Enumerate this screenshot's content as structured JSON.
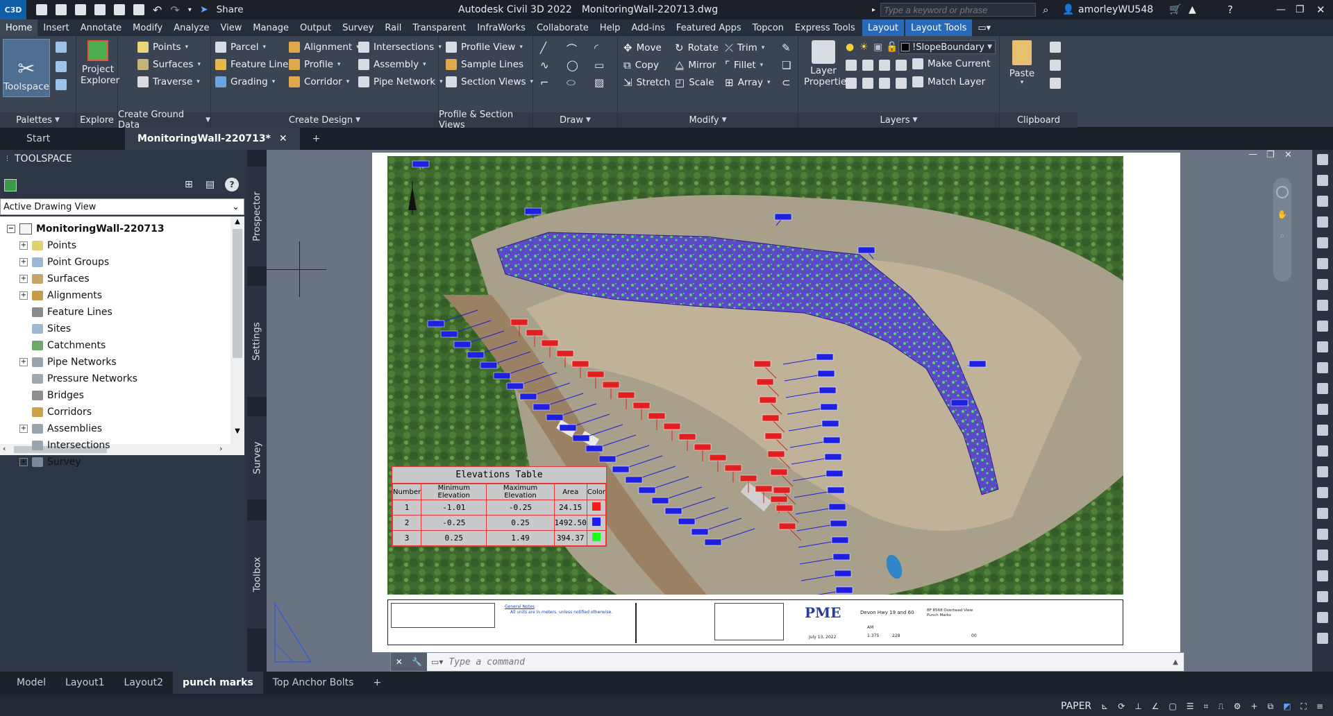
{
  "app": {
    "logo": "C3D",
    "title": "Autodesk Civil 3D 2022",
    "filename": "MonitoringWall-220713.dwg",
    "share": "Share",
    "search_placeholder": "Type a keyword or phrase",
    "user": "amorleyWU548"
  },
  "ribbon_tabs": [
    "Home",
    "Insert",
    "Annotate",
    "Modify",
    "Analyze",
    "View",
    "Manage",
    "Output",
    "Survey",
    "Rail",
    "Transparent",
    "InfraWorks",
    "Collaborate",
    "Help",
    "Add-ins",
    "Featured Apps",
    "Topcon",
    "Express Tools"
  ],
  "context_tabs": [
    "Layout",
    "Layout Tools"
  ],
  "ribbon": {
    "toolspace": "Toolspace",
    "project_explorer_l1": "Project",
    "project_explorer_l2": "Explorer",
    "points": "Points",
    "surfaces": "Surfaces",
    "traverse": "Traverse",
    "parcel": "Parcel",
    "feature_line": "Feature Line",
    "grading": "Grading",
    "alignment": "Alignment",
    "profile": "Profile",
    "corridor": "Corridor",
    "intersections": "Intersections",
    "assembly": "Assembly",
    "pipe_network": "Pipe Network",
    "profile_view": "Profile View",
    "sample_lines": "Sample Lines",
    "section_views": "Section Views",
    "move": "Move",
    "copy": "Copy",
    "stretch": "Stretch",
    "rotate": "Rotate",
    "mirror": "Mirror",
    "scale": "Scale",
    "trim": "Trim",
    "fillet": "Fillet",
    "array": "Array",
    "layer_props_l1": "Layer",
    "layer_props_l2": "Properties",
    "layer_name": "!SlopeBoundary",
    "make_current": "Make Current",
    "match_layer": "Match Layer",
    "paste": "Paste",
    "panels": {
      "palettes": "Palettes",
      "explore": "Explore",
      "create_ground": "Create Ground Data",
      "create_design": "Create Design",
      "profile_section": "Profile & Section Views",
      "draw": "Draw",
      "modify": "Modify",
      "layers": "Layers",
      "clipboard": "Clipboard"
    }
  },
  "doc_tabs": {
    "start": "Start",
    "active": "MonitoringWall-220713*"
  },
  "toolspace": {
    "title": "TOOLSPACE",
    "view": "Active Drawing View",
    "root": "MonitoringWall-220713",
    "items": [
      "Points",
      "Point Groups",
      "Surfaces",
      "Alignments",
      "Feature Lines",
      "Sites",
      "Catchments",
      "Pipe Networks",
      "Pressure Networks",
      "Bridges",
      "Corridors",
      "Assemblies",
      "Intersections",
      "Survey"
    ],
    "side_tabs": [
      "Prospector",
      "Settings",
      "Survey",
      "Toolbox"
    ]
  },
  "elevations_table": {
    "title": "Elevations Table",
    "headers": [
      "Number",
      "Minimum Elevation",
      "Maximum Elevation",
      "Area",
      "Color"
    ],
    "rows": [
      {
        "number": "1",
        "min": "-1.01",
        "max": "-0.25",
        "area": "24.15",
        "color": "#ff1a1a"
      },
      {
        "number": "2",
        "min": "-0.25",
        "max": "0.25",
        "area": "1492.50",
        "color": "#1a1aff"
      },
      {
        "number": "3",
        "min": "0.25",
        "max": "1.49",
        "area": "394.37",
        "color": "#1aff1a"
      }
    ]
  },
  "titleblock": {
    "notes_title": "General Notes",
    "notes_line": "All units are in meters, unless notified otherwise.",
    "logo": "PME",
    "date": "July 13, 2022",
    "project": "Devon Hwy 19 and 60",
    "scale": "1:375",
    "sheet_title": "BF 8568 Overhead View",
    "sheet_subtitle": "Punch Marks",
    "initials": "AM",
    "number": "228",
    "page": "00"
  },
  "command_placeholder": "Type a command",
  "layout_tabs": [
    "Model",
    "Layout1",
    "Layout2",
    "punch marks",
    "Top Anchor Bolts"
  ],
  "active_layout": "punch marks",
  "status": {
    "space": "PAPER"
  }
}
